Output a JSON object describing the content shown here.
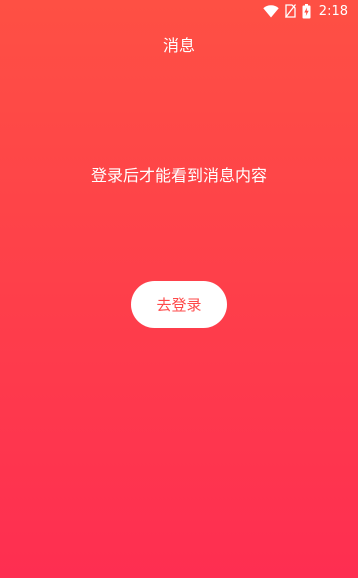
{
  "status_bar": {
    "time": "2:18",
    "icons": [
      "wifi-icon",
      "no-sim-icon",
      "battery-charging-icon"
    ]
  },
  "header": {
    "title": "消息"
  },
  "main": {
    "login_prompt": "登录后才能看到消息内容",
    "login_button_label": "去登录"
  },
  "colors": {
    "background_top": "#fe5044",
    "background_bottom": "#fe2e51",
    "button_background": "#ffffff",
    "button_text": "#fe4a4a"
  }
}
